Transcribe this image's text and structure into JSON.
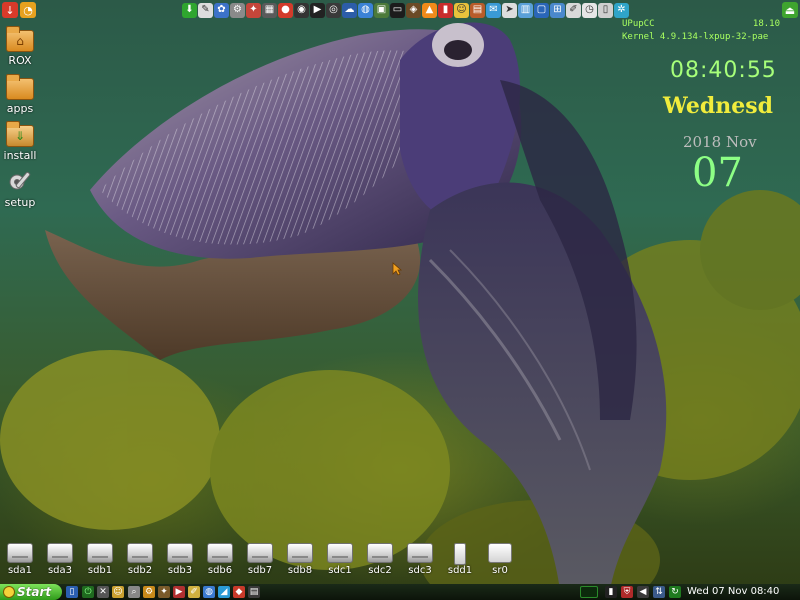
{
  "top_tray": {
    "left_buttons": [
      {
        "name": "shutdown-icon",
        "color": "#d93a2a",
        "glyph": "↓"
      },
      {
        "name": "menu-icon",
        "color": "#e7a11f",
        "glyph": "◔"
      }
    ],
    "launchers": [
      {
        "name": "download-icon",
        "color": "#2fa52f",
        "glyph": "⬇"
      },
      {
        "name": "text-editor-icon",
        "color": "#dddddd",
        "glyph": "✎"
      },
      {
        "name": "paint-icon",
        "color": "#3c72c8",
        "glyph": "✿"
      },
      {
        "name": "settings-gear-icon",
        "color": "#8a8a8a",
        "glyph": "⚙"
      },
      {
        "name": "wizard-icon",
        "color": "#c4463a",
        "glyph": "✦"
      },
      {
        "name": "calculator-icon",
        "color": "#5a5a5a",
        "glyph": "▦"
      },
      {
        "name": "record-icon",
        "color": "#d23b2b",
        "glyph": "●"
      },
      {
        "name": "web-camera-icon",
        "color": "#333333",
        "glyph": "◉"
      },
      {
        "name": "media-player-icon",
        "color": "#222222",
        "glyph": "▶"
      },
      {
        "name": "cd-burner-icon",
        "color": "#3a3a3a",
        "glyph": "◎"
      },
      {
        "name": "network-icon",
        "color": "#2c5da8",
        "glyph": "☁"
      },
      {
        "name": "browser-icon",
        "color": "#3b82d6",
        "glyph": "◍"
      },
      {
        "name": "image-viewer-icon",
        "color": "#4c7a3a",
        "glyph": "▣"
      },
      {
        "name": "terminal-icon",
        "color": "#1c1c1c",
        "glyph": "▭"
      },
      {
        "name": "owl-icon",
        "color": "#6b4a26",
        "glyph": "◈"
      },
      {
        "name": "vlc-icon",
        "color": "#f08a1a",
        "glyph": "▲"
      },
      {
        "name": "mixer-icon",
        "color": "#c82c2c",
        "glyph": "▮"
      },
      {
        "name": "puppy-face-icon",
        "color": "#e8c23c",
        "glyph": "☺"
      },
      {
        "name": "firewall-icon",
        "color": "#b85c2a",
        "glyph": "▤"
      },
      {
        "name": "chat-icon",
        "color": "#3a9ad6",
        "glyph": "✉"
      },
      {
        "name": "pointer-icon",
        "color": "#dddddd",
        "glyph": "➤"
      },
      {
        "name": "file-manager-icon",
        "color": "#5aa0d8",
        "glyph": "▥"
      },
      {
        "name": "window-icon",
        "color": "#2a66b8",
        "glyph": "▢"
      },
      {
        "name": "screenshot-icon",
        "color": "#4a88cc",
        "glyph": "⊞"
      },
      {
        "name": "editor-icon",
        "color": "#d9d9d9",
        "glyph": "✐"
      },
      {
        "name": "clock-icon",
        "color": "#e6e6e6",
        "glyph": "◷"
      },
      {
        "name": "clipboard-icon",
        "color": "#cfcfcf",
        "glyph": "▯"
      },
      {
        "name": "preferences-icon",
        "color": "#2fa4c8",
        "glyph": "✲"
      }
    ],
    "right_button": {
      "name": "exit-icon",
      "color": "#3fa42f",
      "glyph": "⏏"
    }
  },
  "desktop_icons": [
    {
      "label": "ROX",
      "type": "folder-home"
    },
    {
      "label": "apps",
      "type": "folder"
    },
    {
      "label": "install",
      "type": "package"
    },
    {
      "label": "setup",
      "type": "gear"
    }
  ],
  "sysinfo": {
    "distro": "UPupCC",
    "version": "18.10",
    "kernel": "Kernel 4.9.134-lxpup-32-pae"
  },
  "clock": {
    "time": "08:40:55",
    "weekday": "Wednesd",
    "year_month": "2018 Nov",
    "day": "07"
  },
  "drives": [
    {
      "label": "sda1",
      "type": "hdd"
    },
    {
      "label": "sda3",
      "type": "hdd"
    },
    {
      "label": "sdb1",
      "type": "hdd"
    },
    {
      "label": "sdb2",
      "type": "hdd"
    },
    {
      "label": "sdb3",
      "type": "hdd"
    },
    {
      "label": "sdb6",
      "type": "hdd"
    },
    {
      "label": "sdb7",
      "type": "hdd"
    },
    {
      "label": "sdb8",
      "type": "hdd"
    },
    {
      "label": "sdc1",
      "type": "hdd"
    },
    {
      "label": "sdc2",
      "type": "hdd"
    },
    {
      "label": "sdc3",
      "type": "hdd"
    },
    {
      "label": "sdd1",
      "type": "usb"
    },
    {
      "label": "sr0",
      "type": "cd"
    }
  ],
  "taskbar": {
    "start_label": "Start",
    "clock": "Wed 07 Nov 08:40",
    "colors": {
      "start": "#3fb82a",
      "bar": "#111a10"
    }
  }
}
